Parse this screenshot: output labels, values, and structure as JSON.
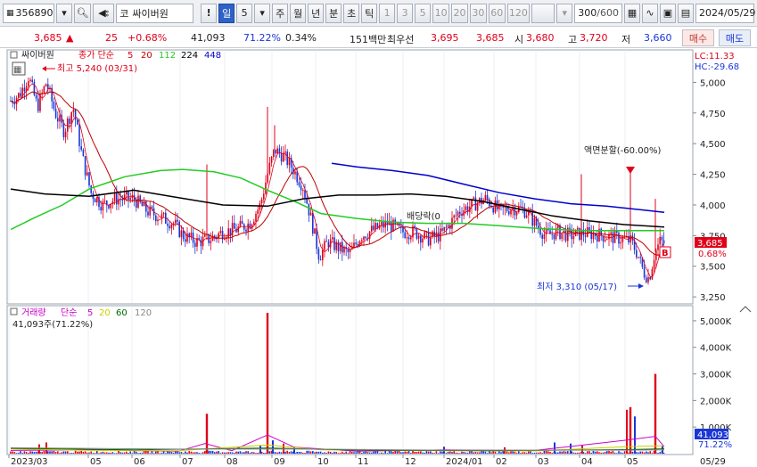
{
  "toolbar": {
    "code": "356890",
    "market": "코",
    "name": "싸이버원",
    "period_day": "일",
    "period_num": "5",
    "periods": [
      "주",
      "월",
      "년",
      "분",
      "초",
      "틱"
    ],
    "intervals": [
      "1",
      "3",
      "5",
      "10",
      "20",
      "30",
      "60",
      "120"
    ],
    "count": "300",
    "count_max": "/600",
    "date": "2024/05/29"
  },
  "quote": {
    "price": "3,685",
    "change_arrow": "▲",
    "change": "25",
    "change_pct": "+0.68%",
    "volume": "41,093",
    "vol_ratio": "71.22%",
    "turnover": "0.34%",
    "amount": "151백만",
    "priority_label": "최우선",
    "ask": "3,695",
    "bid": "3,685",
    "open_label": "시",
    "open": "3,680",
    "high_label": "고",
    "high": "3,720",
    "low_label": "저",
    "low": "3,660",
    "buy": "매수",
    "sell": "매도"
  },
  "price_panel": {
    "stock_name": "싸이버원",
    "legend_prefix": "종가 단순",
    "ma_periods": [
      "5",
      "20",
      "112",
      "224",
      "448"
    ],
    "ma_colors": [
      "#e0001a",
      "#c00000",
      "#22cc22",
      "#000000",
      "#0000cc"
    ],
    "lc": "LC:11.33",
    "hc": "HC:-29.68",
    "max_annotation": "최고 5,240 (03/31)",
    "min_annotation": "최저 3,310 (05/17)",
    "split_annotation": "액면분할(-60.00%)",
    "dividend_annotation": "배당락(0",
    "current_price": "3,685",
    "current_pct": "0.68%",
    "b_marker": "B",
    "y_ticks": [
      "5,000",
      "4,750",
      "4,500",
      "4,250",
      "4,000",
      "3,750",
      "3,500",
      "3,250"
    ]
  },
  "volume_panel": {
    "title": "거래량",
    "legend_prefix": "단순",
    "ma_periods": [
      "5",
      "20",
      "60",
      "120"
    ],
    "ma_colors": [
      "#cc00cc",
      "#cccc00",
      "#006600",
      "#888888"
    ],
    "sub": "41,093주(71.22%)",
    "current": "41,093",
    "current_pct": "71.22%",
    "y_ticks": [
      "5,000K",
      "4,000K",
      "3,000K",
      "2,000K",
      "1,000K"
    ]
  },
  "x_axis": {
    "labels": [
      "2023/03",
      "05",
      "06",
      "07",
      "08",
      "09",
      "10",
      "11",
      "12",
      "2024/01",
      "02",
      "03",
      "04",
      "05",
      "05/29"
    ]
  },
  "chart_data": {
    "type": "candlestick",
    "y_range": [
      3200,
      5250
    ],
    "max": {
      "value": 5240,
      "date": "03/31"
    },
    "min": {
      "value": 3310,
      "date": "05/17"
    },
    "last_close": 3685,
    "volume_range_k": [
      0,
      5500
    ],
    "volume_spikes_k": [
      {
        "month": "07",
        "value": 1500
      },
      {
        "month": "08",
        "value": 5300
      },
      {
        "month": "05",
        "value": 1750
      },
      {
        "month": "05/29",
        "value": 3000
      }
    ]
  }
}
